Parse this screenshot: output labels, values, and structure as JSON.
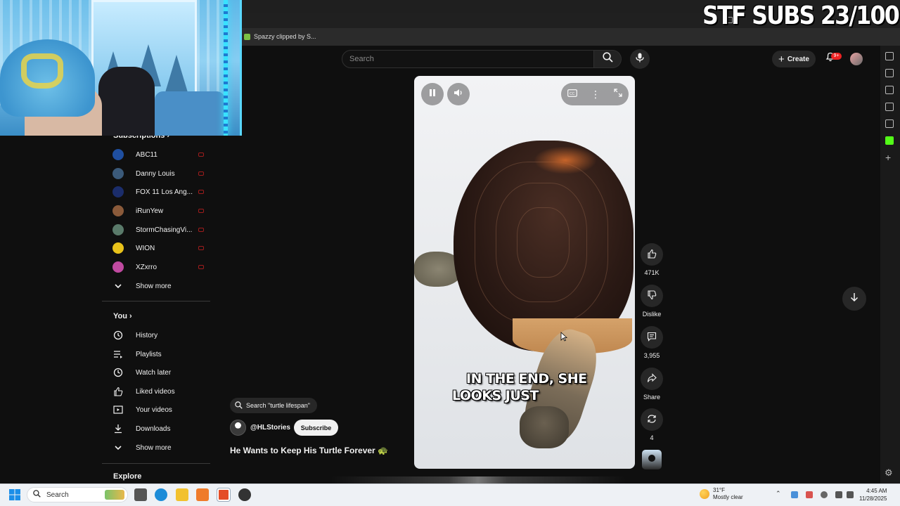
{
  "overlay": {
    "stf_text": "STF SUBS 23/100"
  },
  "browser": {
    "bookmark_label": "Spazzy clipped by S..."
  },
  "header": {
    "search_placeholder": "Search",
    "create_label": "Create",
    "notifications_badge": "9+"
  },
  "sidebar": {
    "subscriptions_heading": "Subscriptions",
    "subscriptions": [
      {
        "name": "ABC11",
        "color": "#1f4fa0"
      },
      {
        "name": "Danny Louis",
        "color": "#3b5a7a"
      },
      {
        "name": "FOX 11 Los Ang...",
        "color": "#1b2d6b"
      },
      {
        "name": "iRunYew",
        "color": "#8a5a3a"
      },
      {
        "name": "StormChasingVi...",
        "color": "#5a7a6a"
      },
      {
        "name": "WION",
        "color": "#e8c21a"
      },
      {
        "name": "XZxrro",
        "color": "#c04aa0"
      }
    ],
    "show_more_1": "Show more",
    "you_heading": "You",
    "you_items": [
      "History",
      "Playlists",
      "Watch later",
      "Liked videos",
      "Your videos",
      "Downloads"
    ],
    "show_more_2": "Show more",
    "explore_heading": "Explore"
  },
  "video": {
    "caption_line1": "IN THE END, SHE",
    "caption_line2": "LOOKS JUST"
  },
  "actions": {
    "likes": "471K",
    "dislike_label": "Dislike",
    "comments": "3,955",
    "share_label": "Share",
    "remix_count": "4"
  },
  "info": {
    "suggested_search": "Search \"turtle lifespan\"",
    "channel": "@HLStories",
    "subscribe_label": "Subscribe",
    "title": "He Wants to Keep His Turtle Forever 🐢"
  },
  "taskbar": {
    "search_label": "Search",
    "temperature": "31°F",
    "weather_desc": "Mostly clear",
    "time": "4:45 AM",
    "date": "11/28/2025"
  }
}
